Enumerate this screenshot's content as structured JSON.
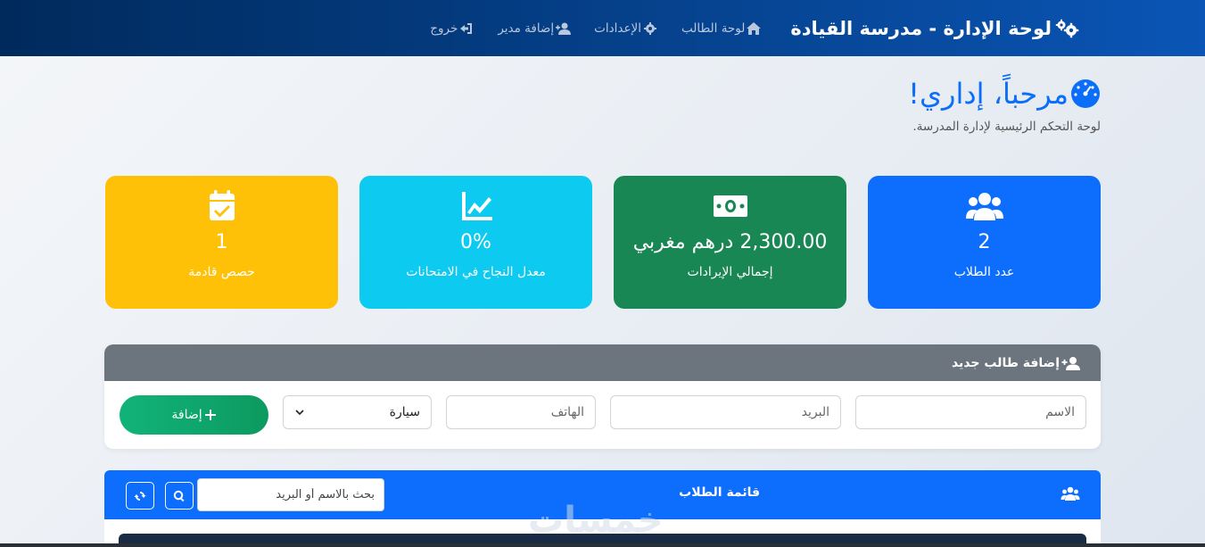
{
  "navbar": {
    "brand": "لوحة الإدارة - مدرسة القيادة",
    "links": [
      {
        "label": "لوحة الطالب",
        "icon": "home-icon"
      },
      {
        "label": "الإعدادات",
        "icon": "gear-icon"
      },
      {
        "label": "إضافة مدير",
        "icon": "user-plus-icon"
      },
      {
        "label": "خروج",
        "icon": "logout-icon"
      }
    ]
  },
  "welcome": {
    "title": "مرحباً، إداري!",
    "subtitle": "لوحة التحكم الرئيسية لإدارة المدرسة."
  },
  "stats": {
    "students": {
      "value": "2",
      "label": "عدد الطلاب",
      "color": "#0d6efd"
    },
    "revenue": {
      "value": "2,300.00 درهم مغربي",
      "label": "إجمالي الإيرادات",
      "color": "#198754"
    },
    "pass_rate": {
      "value": "0%",
      "label": "معدل النجاح في الامتحانات",
      "color": "#0dcaf0"
    },
    "lessons": {
      "value": "1",
      "label": "حصص قادمة",
      "color": "#ffc107"
    }
  },
  "add_student": {
    "title": "إضافة طالب جديد",
    "name_placeholder": "الاسم",
    "email_placeholder": "البريد",
    "phone_placeholder": "الهاتف",
    "vehicle_selected": "سيارة",
    "add_label": "إضافة"
  },
  "student_list": {
    "title": "قائمة الطلاب",
    "search_placeholder": "بحث بالاسم أو البريد"
  },
  "watermark": "خمسات"
}
